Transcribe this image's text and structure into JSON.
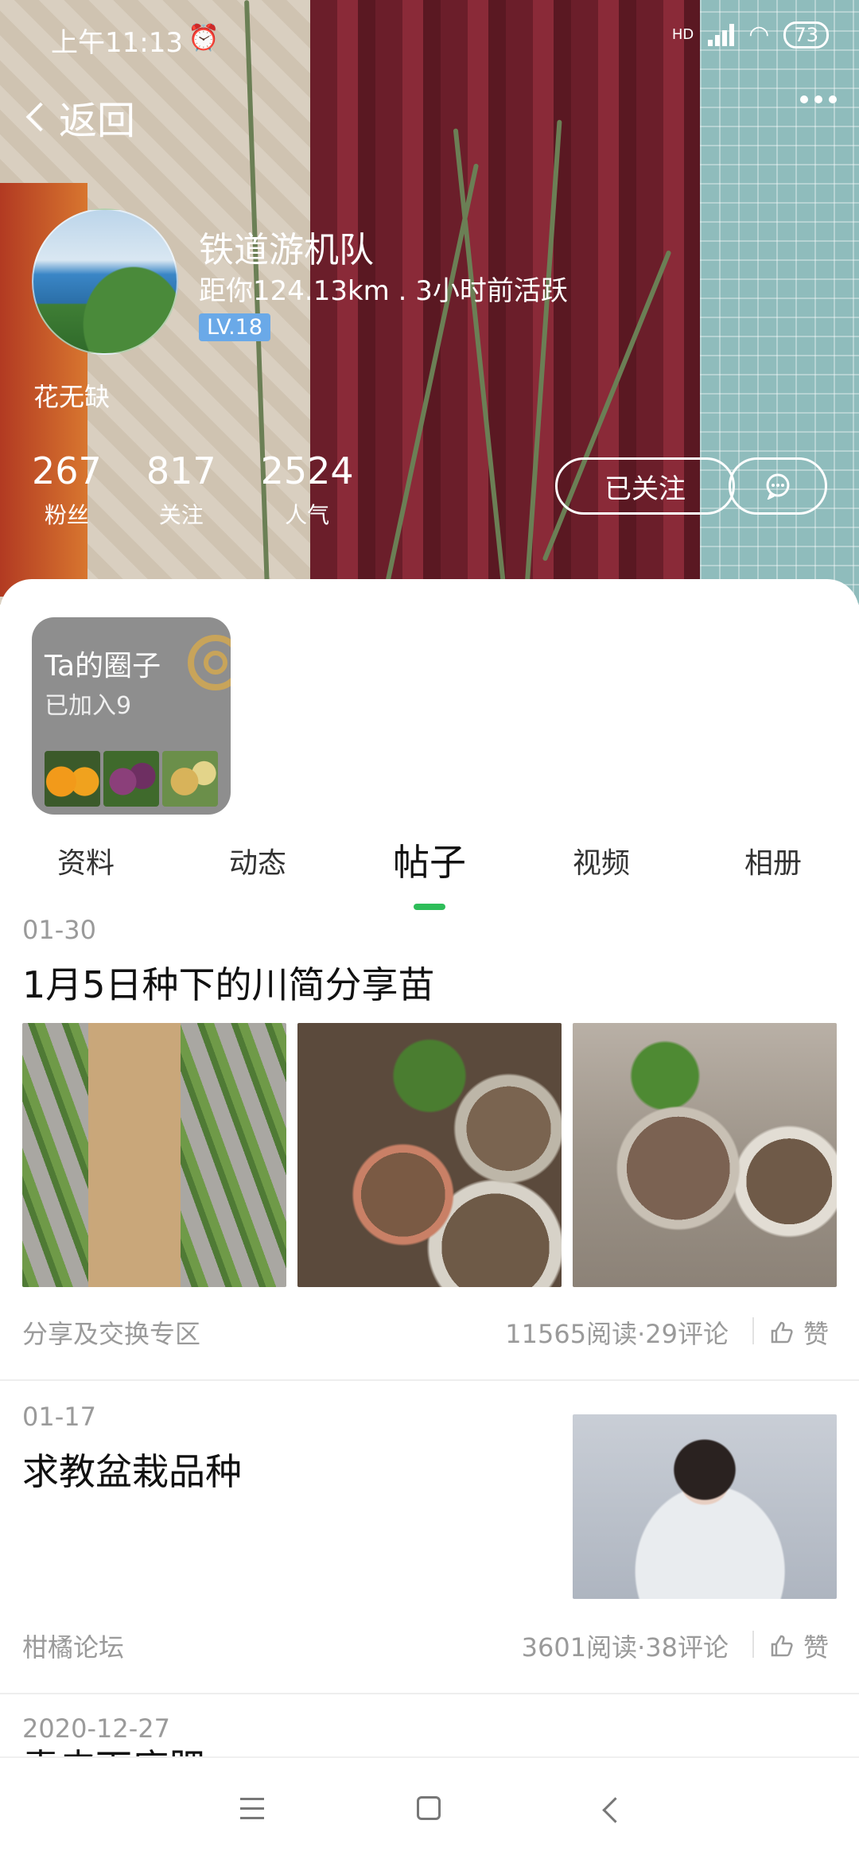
{
  "status_bar": {
    "time": "上午11:13",
    "network": "HD",
    "battery": "73"
  },
  "header": {
    "back_label": "返回",
    "username": "铁道游机队",
    "meta": "距你124.13km . 3小时前活跃",
    "level": "LV.18",
    "nickname": "花无缺",
    "stats": [
      {
        "value": "267",
        "label": "粉丝"
      },
      {
        "value": "817",
        "label": "关注"
      },
      {
        "value": "2524",
        "label": "人气"
      }
    ],
    "follow_label": "已关注"
  },
  "circle": {
    "title": "Ta的圈子",
    "joined": "已加入9"
  },
  "tabs": [
    {
      "label": "资料",
      "active": false
    },
    {
      "label": "动态",
      "active": false
    },
    {
      "label": "帖子",
      "active": true
    },
    {
      "label": "视频",
      "active": false
    },
    {
      "label": "相册",
      "active": false
    }
  ],
  "posts": [
    {
      "date": "01-30",
      "title": "1月5日种下的川简分享苗",
      "forum": "分享及交换专区",
      "stats": "11565阅读·29评论",
      "like_label": "赞"
    },
    {
      "date": "01-17",
      "title": "求教盆栽品种",
      "forum": "柑橘论坛",
      "stats": "3601阅读·38评论",
      "like_label": "赞"
    },
    {
      "date": "2020-12-27",
      "title": "青皮下底肥"
    }
  ],
  "colors": {
    "accent": "#2ebd59",
    "level_badge": "#6aa9e8",
    "muted_text": "#9a9a9a"
  }
}
